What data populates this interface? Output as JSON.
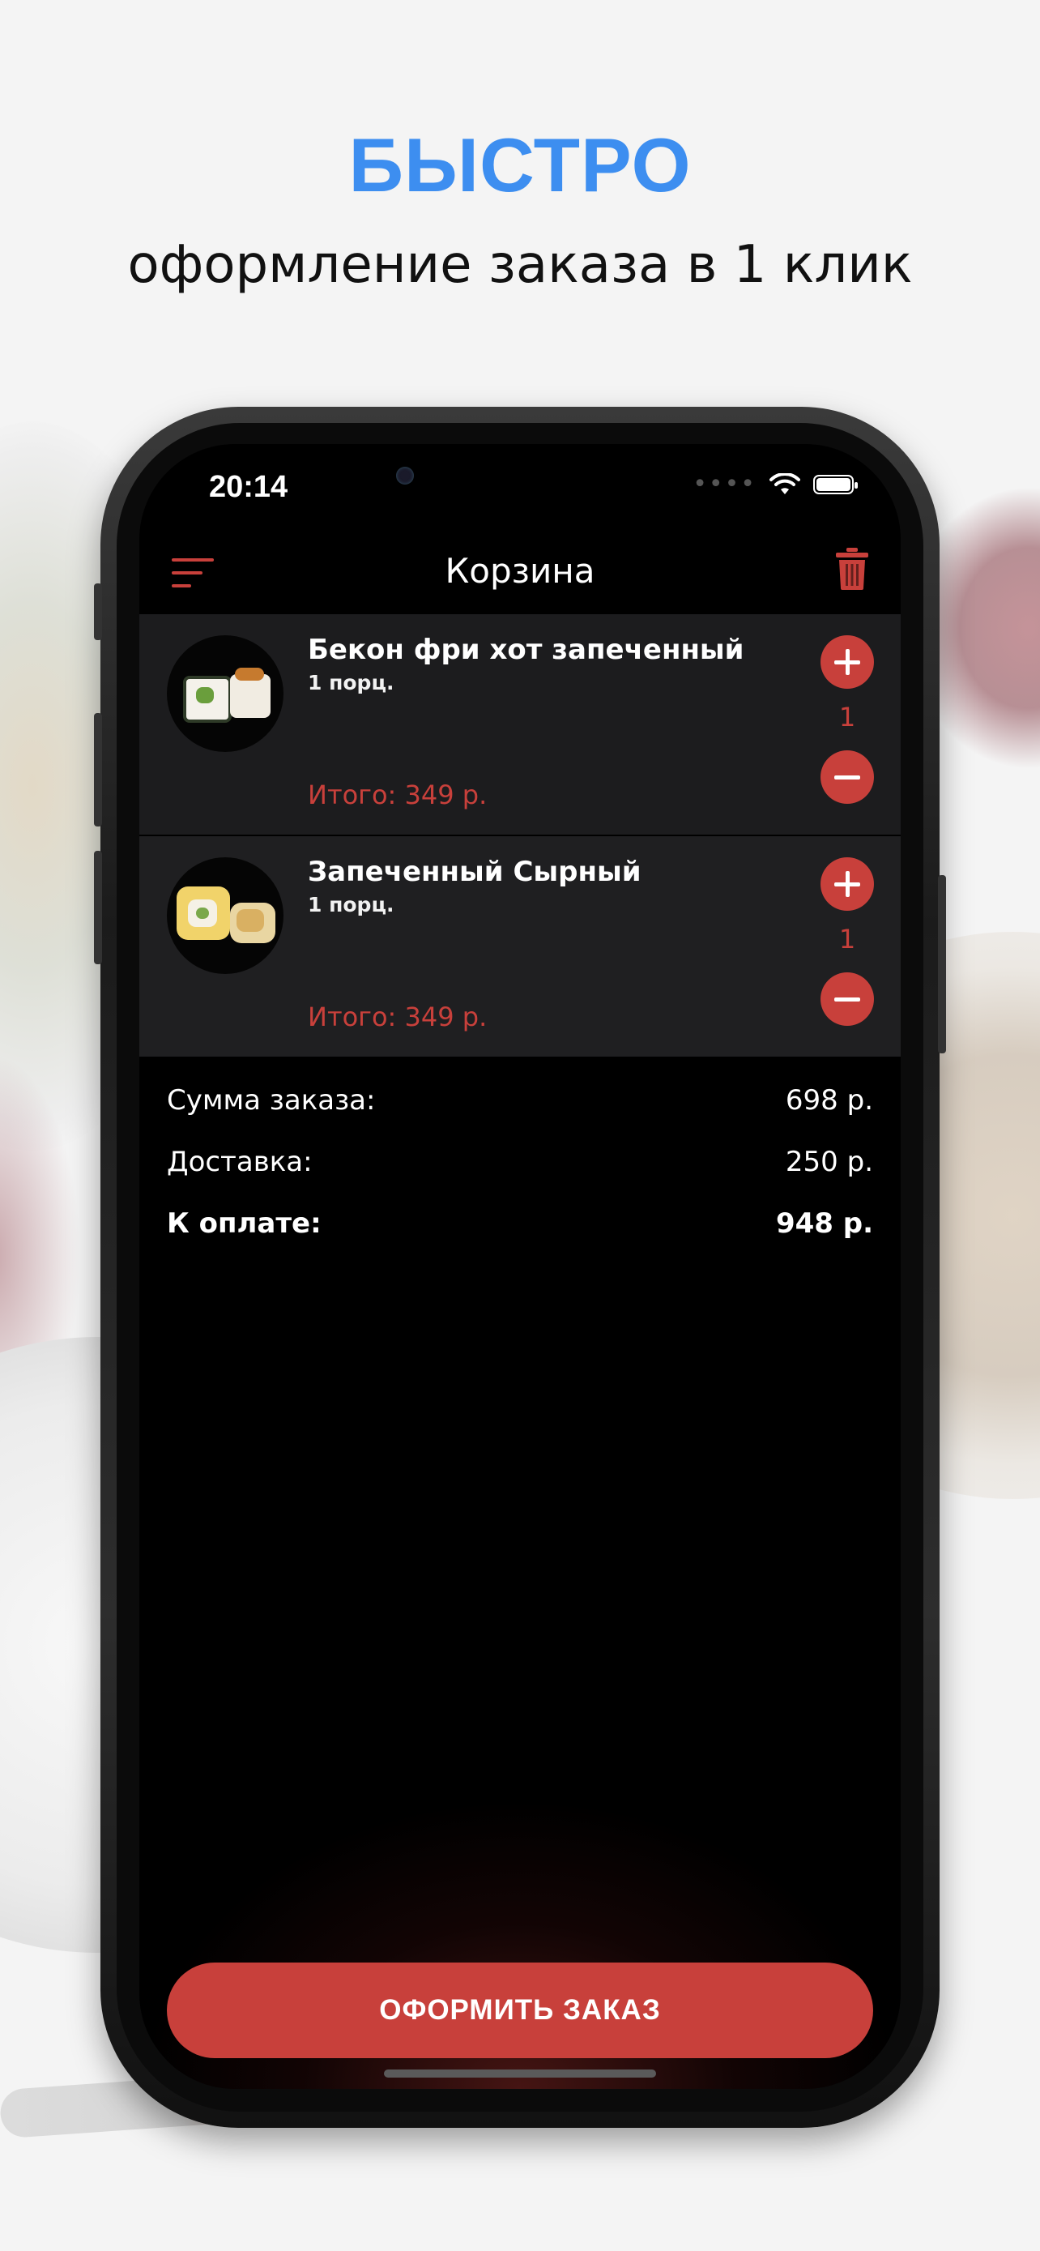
{
  "promo": {
    "headline": "БЫСТРО",
    "subline": "оформление заказа в 1 клик"
  },
  "status_bar": {
    "time": "20:14",
    "signal_icon": "signal-dots-icon",
    "wifi_icon": "wifi-icon",
    "battery_icon": "battery-icon",
    "battery_level": 1.0
  },
  "header": {
    "title": "Корзина",
    "menu_icon": "menu-icon",
    "trash_icon": "trash-icon"
  },
  "cart": {
    "items": [
      {
        "name": "Бекон фри хот запеченный",
        "portion": "1 порц.",
        "total": "Итого: 349 р.",
        "quantity": "1"
      },
      {
        "name": "Запеченный Сырный",
        "portion": "1 порц.",
        "total": "Итого: 349 р.",
        "quantity": "1"
      }
    ]
  },
  "summary": {
    "subtotal_label": "Сумма заказа:",
    "subtotal_value": "698 р.",
    "delivery_label": "Доставка:",
    "delivery_value": "250 р.",
    "pay_label": "К оплате:",
    "pay_value": "948 р."
  },
  "checkout": {
    "button_label": "ОФОРМИТЬ ЗАКАЗ"
  },
  "colors": {
    "accent": "#c8403b",
    "headline": "#3d8ef0",
    "screen_bg": "#000000",
    "item_bg": "#1c1c1e"
  }
}
